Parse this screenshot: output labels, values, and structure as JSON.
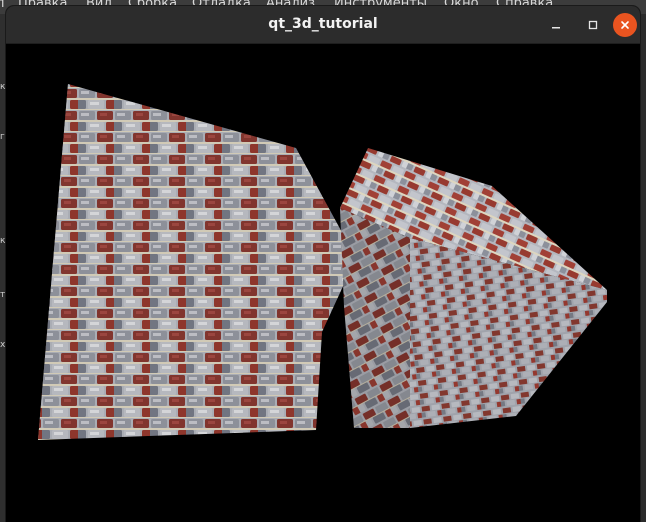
{
  "background_menubar": {
    "items": [
      "п",
      "Правка",
      "Вид",
      "Сборка",
      "Отладка",
      "Анализ",
      "Инструменты",
      "Окно",
      "Справка"
    ]
  },
  "background_sidebar": {
    "fragments": [
      "к",
      "г",
      "к",
      "т",
      "х"
    ]
  },
  "window": {
    "title": "qt_3d_tutorial",
    "controls": {
      "minimize_icon": "minimize-icon",
      "maximize_icon": "maximize-icon",
      "close_icon": "close-icon"
    },
    "colors": {
      "titlebar": "#2c2c2c",
      "close_button": "#e95420",
      "viewport": "#000000"
    }
  },
  "scene": {
    "objects": [
      "textured-cube-left",
      "textured-cube-right"
    ],
    "texture": "red-brick"
  }
}
